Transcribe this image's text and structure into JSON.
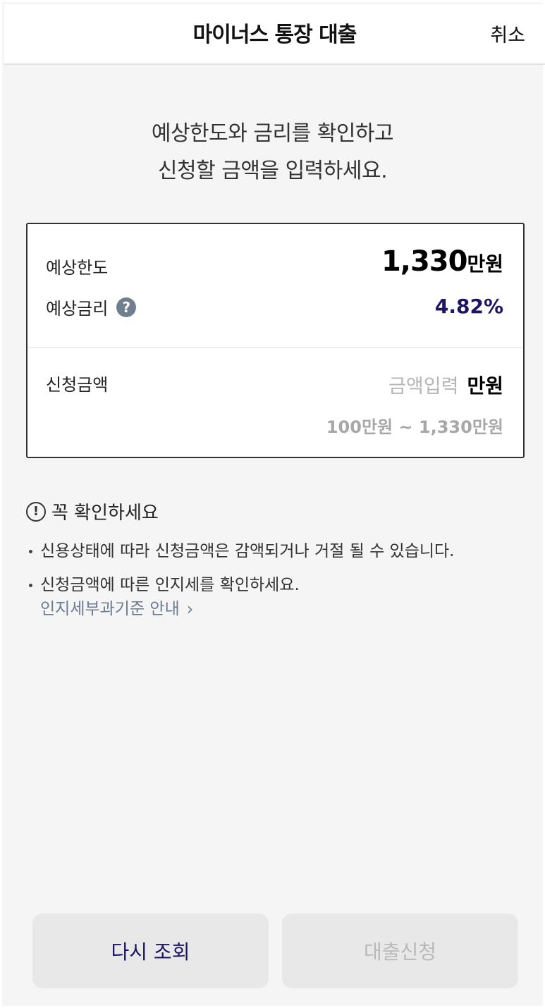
{
  "header": {
    "title": "마이너스 통장 대출",
    "cancel_label": "취소"
  },
  "headline": {
    "line1": "예상한도와 금리를 확인하고",
    "line2": "신청할 금액을 입력하세요."
  },
  "card": {
    "limit_label": "예상한도",
    "limit_amount": "1,330",
    "limit_unit": "만원",
    "rate_label": "예상금리",
    "help_icon": "?",
    "rate_value": "4.82%",
    "apply_label": "신청금액",
    "apply_placeholder": "금액입력",
    "apply_value": "",
    "apply_unit": "만원",
    "range_text": "100만원 ~ 1,330만원"
  },
  "notice": {
    "title": "꼭 확인하세요",
    "icon": "!",
    "items": [
      "신용상태에 따라 신청금액은 감액되거나 거절 될 수 있습니다.",
      "신청금액에 따른 인지세를 확인하세요."
    ],
    "link_label": "인지세부과기준 안내",
    "link_chevron": "›"
  },
  "buttons": {
    "retry_label": "다시 조회",
    "apply_label": "대출신청"
  },
  "colors": {
    "accent": "#1e1464",
    "disabled_text": "#b9b9b9",
    "button_bg": "#e8e8e8",
    "link": "#6b7c92"
  }
}
